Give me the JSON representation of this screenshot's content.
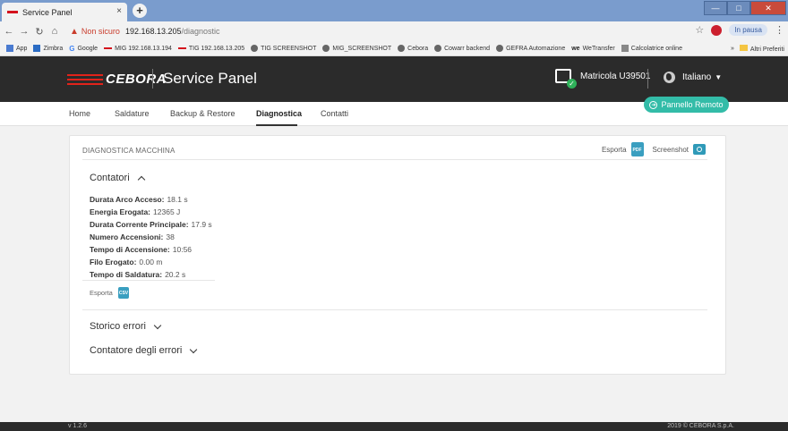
{
  "browser": {
    "tab_title": "Service Panel",
    "tab_close": "×",
    "new_tab": "+",
    "address": {
      "not_secure": "Non sicuro",
      "host": "192.168.13.205",
      "path": "/diagnostic"
    },
    "pause_label": "In pausa",
    "bookmarks": [
      "App",
      "Zimbra",
      "Google",
      "MIG 192.168.13.194",
      "TIG 192.168.13.205",
      "TIG SCREENSHOT",
      "MIG_SCREENSHOT",
      "Cebora",
      "Cowarr backend",
      "GEFRA Automazione",
      "WeTransfer",
      "Calcolatrice online"
    ],
    "bookmarks_more": "»",
    "other_bookmarks": "Altri Preferiti"
  },
  "header": {
    "logo_text": "CEBORA",
    "title": "Service Panel",
    "matricola": "Matricola U39501",
    "language": "Italiano"
  },
  "nav": {
    "items": [
      "Home",
      "Saldature",
      "Backup & Restore",
      "Diagnostica",
      "Contatti"
    ],
    "remote_button": "Pannello Remoto"
  },
  "card": {
    "title": "DIAGNOSTICA MACCHINA",
    "export_label": "Esporta",
    "pdf_label": "PDF",
    "screenshot_label": "Screenshot",
    "counters_title": "Contatori",
    "counters": [
      {
        "label": "Durata Arco Acceso:",
        "value": "18.1 s"
      },
      {
        "label": "Energia Erogata:",
        "value": "12365 J"
      },
      {
        "label": "Durata Corrente Principale:",
        "value": "17.9 s"
      },
      {
        "label": "Numero Accensioni:",
        "value": "38"
      },
      {
        "label": "Tempo di Accensione:",
        "value": "10:56"
      },
      {
        "label": "Filo Erogato:",
        "value": "0.00 m"
      },
      {
        "label": "Tempo di Saldatura:",
        "value": "20.2 s"
      }
    ],
    "export_small": "Esporta",
    "csv_label": "CSV",
    "error_history_title": "Storico errori",
    "error_counter_title": "Contatore degli errori"
  },
  "footer": {
    "version": "v 1.2.6",
    "copyright": "2019 © CEBORA S.p.A."
  },
  "colors": {
    "brand_red": "#e2231a",
    "accent_teal": "#33bca8",
    "header_dark": "#2b2b2b"
  }
}
